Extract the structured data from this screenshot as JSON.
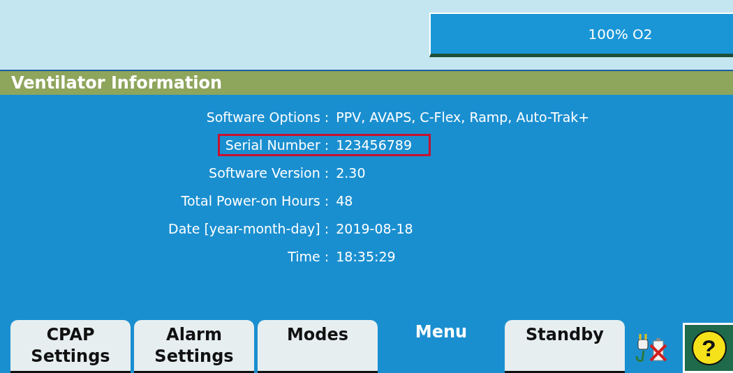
{
  "oxygen_button": {
    "label": "100% O2"
  },
  "panel": {
    "title": "Ventilator Information",
    "rows": [
      {
        "label": "Software Options :",
        "value": "PPV, AVAPS, C-Flex, Ramp, Auto-Trak+",
        "highlighted": false
      },
      {
        "label": "Serial Number :",
        "value": "123456789",
        "highlighted": true
      },
      {
        "label": "Software Version :",
        "value": "2.30",
        "highlighted": false
      },
      {
        "label": "Total Power-on Hours :",
        "value": "48",
        "highlighted": false
      },
      {
        "label": "Date [year-month-day] :",
        "value": "2019-08-18",
        "highlighted": false
      },
      {
        "label": "Time :",
        "value": "18:35:29",
        "highlighted": false
      }
    ]
  },
  "tabs": [
    {
      "label": "CPAP Settings",
      "selected": false
    },
    {
      "label": "Alarm Settings",
      "selected": false
    },
    {
      "label": "Modes",
      "selected": false
    },
    {
      "label": "Menu",
      "selected": true
    },
    {
      "label": "Standby",
      "selected": false
    }
  ],
  "help_button": {
    "label": "?"
  }
}
